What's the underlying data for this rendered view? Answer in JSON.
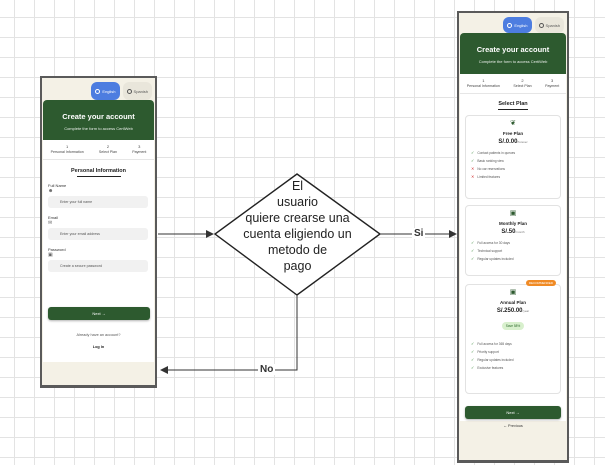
{
  "left_screen": {
    "lang_english": "English",
    "lang_spanish": "Spanish",
    "title": "Create your account",
    "subtitle": "Complete the form to access CertiWeb",
    "steps": [
      {
        "num": "1",
        "label": "Personal Information"
      },
      {
        "num": "2",
        "label": "Select Plan"
      },
      {
        "num": "3",
        "label": "Payment"
      }
    ],
    "section_title": "Personal Information",
    "fields": {
      "name_label": "Full Name",
      "name_placeholder": "Enter your full name",
      "email_label": "Email",
      "email_placeholder": "Enter your email address",
      "password_label": "Password",
      "password_placeholder": "Create a secure password"
    },
    "next_button": "Next  →",
    "have_account": "Already have an account?",
    "login": "Log In"
  },
  "right_screen": {
    "lang_english": "English",
    "lang_spanish": "Spanish",
    "title": "Create your account",
    "subtitle": "Complete the form to access CertiWeb",
    "steps": [
      {
        "num": "1",
        "label": "Personal Information"
      },
      {
        "num": "2",
        "label": "Select Plan"
      },
      {
        "num": "3",
        "label": "Payment"
      }
    ],
    "section_title": "Select Plan",
    "plans": [
      {
        "name": "Free Plan",
        "price": "S/.0.00",
        "period": "/forever",
        "features": [
          {
            "text": "Contact patients in queues",
            "ok": true
          },
          {
            "text": "Basic ranking view",
            "ok": true
          },
          {
            "text": "No car reservations",
            "ok": false
          },
          {
            "text": "Limited features",
            "ok": false
          }
        ]
      },
      {
        "name": "Monthly Plan",
        "price": "S/.50",
        "period": "/month",
        "features": [
          {
            "text": "Full access for 30 days",
            "ok": true
          },
          {
            "text": "Technical support",
            "ok": true
          },
          {
            "text": "Regular updates included",
            "ok": true
          }
        ]
      },
      {
        "name": "Annual Plan",
        "price": "S/.250.00",
        "period": "/year",
        "badge": "RECOMMENDED",
        "save": "Save 58%",
        "features": [
          {
            "text": "Full access for 365 days",
            "ok": true
          },
          {
            "text": "Priority support",
            "ok": true
          },
          {
            "text": "Regular updates included",
            "ok": true
          },
          {
            "text": "Exclusive features",
            "ok": true
          }
        ]
      }
    ],
    "next_button": "Next  →",
    "previous_button": "←  Previous"
  },
  "diagram": {
    "decision_lines": [
      "El",
      "usuario",
      "quiere crearse una",
      "cuenta eligiendo un",
      "metodo de",
      "pago"
    ],
    "yes_label": "Si",
    "no_label": "No"
  },
  "colors": {
    "brand_green": "#2d5a2f",
    "accent_blue": "#4d7de0",
    "badge_orange": "#f08a24",
    "phone_bg": "#f4f1e6"
  }
}
